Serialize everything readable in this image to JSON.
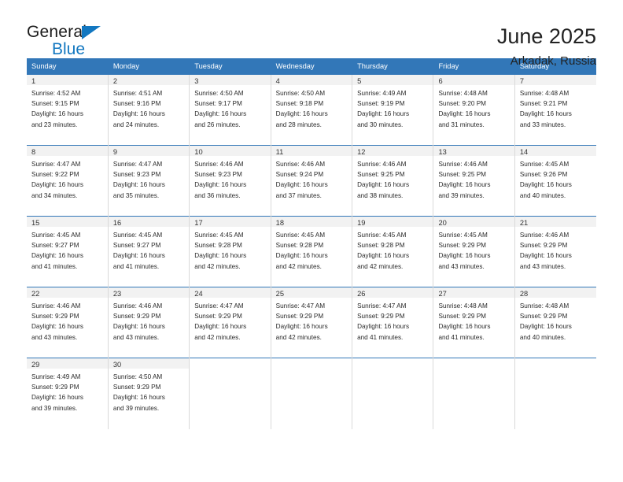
{
  "brand": {
    "name_top": "General",
    "name_bottom": "Blue",
    "triangle_icon": "brand-triangle-icon",
    "accent_color": "#1277c0"
  },
  "header": {
    "title": "June 2025",
    "subtitle": "Arkadak, Russia"
  },
  "theme": {
    "header_blue": "#3277b8",
    "daynum_background": "#f2f2f2",
    "cell_border": "#d9d9d9",
    "text": "#222222"
  },
  "calendar": {
    "weekday_headers": [
      "Sunday",
      "Monday",
      "Tuesday",
      "Wednesday",
      "Thursday",
      "Friday",
      "Saturday"
    ],
    "weeks": [
      [
        {
          "day": "1",
          "sunrise": "Sunrise: 4:52 AM",
          "sunset": "Sunset: 9:15 PM",
          "daylight_line1": "Daylight: 16 hours",
          "daylight_line2": "and 23 minutes."
        },
        {
          "day": "2",
          "sunrise": "Sunrise: 4:51 AM",
          "sunset": "Sunset: 9:16 PM",
          "daylight_line1": "Daylight: 16 hours",
          "daylight_line2": "and 24 minutes."
        },
        {
          "day": "3",
          "sunrise": "Sunrise: 4:50 AM",
          "sunset": "Sunset: 9:17 PM",
          "daylight_line1": "Daylight: 16 hours",
          "daylight_line2": "and 26 minutes."
        },
        {
          "day": "4",
          "sunrise": "Sunrise: 4:50 AM",
          "sunset": "Sunset: 9:18 PM",
          "daylight_line1": "Daylight: 16 hours",
          "daylight_line2": "and 28 minutes."
        },
        {
          "day": "5",
          "sunrise": "Sunrise: 4:49 AM",
          "sunset": "Sunset: 9:19 PM",
          "daylight_line1": "Daylight: 16 hours",
          "daylight_line2": "and 30 minutes."
        },
        {
          "day": "6",
          "sunrise": "Sunrise: 4:48 AM",
          "sunset": "Sunset: 9:20 PM",
          "daylight_line1": "Daylight: 16 hours",
          "daylight_line2": "and 31 minutes."
        },
        {
          "day": "7",
          "sunrise": "Sunrise: 4:48 AM",
          "sunset": "Sunset: 9:21 PM",
          "daylight_line1": "Daylight: 16 hours",
          "daylight_line2": "and 33 minutes."
        }
      ],
      [
        {
          "day": "8",
          "sunrise": "Sunrise: 4:47 AM",
          "sunset": "Sunset: 9:22 PM",
          "daylight_line1": "Daylight: 16 hours",
          "daylight_line2": "and 34 minutes."
        },
        {
          "day": "9",
          "sunrise": "Sunrise: 4:47 AM",
          "sunset": "Sunset: 9:23 PM",
          "daylight_line1": "Daylight: 16 hours",
          "daylight_line2": "and 35 minutes."
        },
        {
          "day": "10",
          "sunrise": "Sunrise: 4:46 AM",
          "sunset": "Sunset: 9:23 PM",
          "daylight_line1": "Daylight: 16 hours",
          "daylight_line2": "and 36 minutes."
        },
        {
          "day": "11",
          "sunrise": "Sunrise: 4:46 AM",
          "sunset": "Sunset: 9:24 PM",
          "daylight_line1": "Daylight: 16 hours",
          "daylight_line2": "and 37 minutes."
        },
        {
          "day": "12",
          "sunrise": "Sunrise: 4:46 AM",
          "sunset": "Sunset: 9:25 PM",
          "daylight_line1": "Daylight: 16 hours",
          "daylight_line2": "and 38 minutes."
        },
        {
          "day": "13",
          "sunrise": "Sunrise: 4:46 AM",
          "sunset": "Sunset: 9:25 PM",
          "daylight_line1": "Daylight: 16 hours",
          "daylight_line2": "and 39 minutes."
        },
        {
          "day": "14",
          "sunrise": "Sunrise: 4:45 AM",
          "sunset": "Sunset: 9:26 PM",
          "daylight_line1": "Daylight: 16 hours",
          "daylight_line2": "and 40 minutes."
        }
      ],
      [
        {
          "day": "15",
          "sunrise": "Sunrise: 4:45 AM",
          "sunset": "Sunset: 9:27 PM",
          "daylight_line1": "Daylight: 16 hours",
          "daylight_line2": "and 41 minutes."
        },
        {
          "day": "16",
          "sunrise": "Sunrise: 4:45 AM",
          "sunset": "Sunset: 9:27 PM",
          "daylight_line1": "Daylight: 16 hours",
          "daylight_line2": "and 41 minutes."
        },
        {
          "day": "17",
          "sunrise": "Sunrise: 4:45 AM",
          "sunset": "Sunset: 9:28 PM",
          "daylight_line1": "Daylight: 16 hours",
          "daylight_line2": "and 42 minutes."
        },
        {
          "day": "18",
          "sunrise": "Sunrise: 4:45 AM",
          "sunset": "Sunset: 9:28 PM",
          "daylight_line1": "Daylight: 16 hours",
          "daylight_line2": "and 42 minutes."
        },
        {
          "day": "19",
          "sunrise": "Sunrise: 4:45 AM",
          "sunset": "Sunset: 9:28 PM",
          "daylight_line1": "Daylight: 16 hours",
          "daylight_line2": "and 42 minutes."
        },
        {
          "day": "20",
          "sunrise": "Sunrise: 4:45 AM",
          "sunset": "Sunset: 9:29 PM",
          "daylight_line1": "Daylight: 16 hours",
          "daylight_line2": "and 43 minutes."
        },
        {
          "day": "21",
          "sunrise": "Sunrise: 4:46 AM",
          "sunset": "Sunset: 9:29 PM",
          "daylight_line1": "Daylight: 16 hours",
          "daylight_line2": "and 43 minutes."
        }
      ],
      [
        {
          "day": "22",
          "sunrise": "Sunrise: 4:46 AM",
          "sunset": "Sunset: 9:29 PM",
          "daylight_line1": "Daylight: 16 hours",
          "daylight_line2": "and 43 minutes."
        },
        {
          "day": "23",
          "sunrise": "Sunrise: 4:46 AM",
          "sunset": "Sunset: 9:29 PM",
          "daylight_line1": "Daylight: 16 hours",
          "daylight_line2": "and 43 minutes."
        },
        {
          "day": "24",
          "sunrise": "Sunrise: 4:47 AM",
          "sunset": "Sunset: 9:29 PM",
          "daylight_line1": "Daylight: 16 hours",
          "daylight_line2": "and 42 minutes."
        },
        {
          "day": "25",
          "sunrise": "Sunrise: 4:47 AM",
          "sunset": "Sunset: 9:29 PM",
          "daylight_line1": "Daylight: 16 hours",
          "daylight_line2": "and 42 minutes."
        },
        {
          "day": "26",
          "sunrise": "Sunrise: 4:47 AM",
          "sunset": "Sunset: 9:29 PM",
          "daylight_line1": "Daylight: 16 hours",
          "daylight_line2": "and 41 minutes."
        },
        {
          "day": "27",
          "sunrise": "Sunrise: 4:48 AM",
          "sunset": "Sunset: 9:29 PM",
          "daylight_line1": "Daylight: 16 hours",
          "daylight_line2": "and 41 minutes."
        },
        {
          "day": "28",
          "sunrise": "Sunrise: 4:48 AM",
          "sunset": "Sunset: 9:29 PM",
          "daylight_line1": "Daylight: 16 hours",
          "daylight_line2": "and 40 minutes."
        }
      ],
      [
        {
          "day": "29",
          "sunrise": "Sunrise: 4:49 AM",
          "sunset": "Sunset: 9:29 PM",
          "daylight_line1": "Daylight: 16 hours",
          "daylight_line2": "and 39 minutes."
        },
        {
          "day": "30",
          "sunrise": "Sunrise: 4:50 AM",
          "sunset": "Sunset: 9:29 PM",
          "daylight_line1": "Daylight: 16 hours",
          "daylight_line2": "and 39 minutes."
        },
        {
          "day": "",
          "sunrise": "",
          "sunset": "",
          "daylight_line1": "",
          "daylight_line2": ""
        },
        {
          "day": "",
          "sunrise": "",
          "sunset": "",
          "daylight_line1": "",
          "daylight_line2": ""
        },
        {
          "day": "",
          "sunrise": "",
          "sunset": "",
          "daylight_line1": "",
          "daylight_line2": ""
        },
        {
          "day": "",
          "sunrise": "",
          "sunset": "",
          "daylight_line1": "",
          "daylight_line2": ""
        },
        {
          "day": "",
          "sunrise": "",
          "sunset": "",
          "daylight_line1": "",
          "daylight_line2": ""
        }
      ]
    ]
  }
}
